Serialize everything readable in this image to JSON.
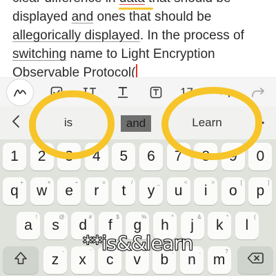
{
  "note": {
    "lines": [
      {
        "segments": [
          {
            "text": "clear difference in ",
            "style": ""
          },
          {
            "text": "data",
            "style": "u u-red"
          },
          {
            "text": " that should be",
            "style": ""
          }
        ]
      },
      {
        "segments": [
          {
            "text": "displayed ",
            "style": ""
          },
          {
            "text": "and",
            "style": "u"
          },
          {
            "text": " ones that should be",
            "style": ""
          }
        ]
      },
      {
        "segments": [
          {
            "text": "allegorically displayed",
            "style": "u"
          },
          {
            "text": ". In the process of",
            "style": ""
          }
        ]
      },
      {
        "segments": [
          {
            "text": "switching",
            "style": "u"
          },
          {
            "text": " name to Light Encryption",
            "style": ""
          }
        ]
      },
      {
        "segments": [
          {
            "text": "Observable Protocol(",
            "style": ""
          }
        ]
      }
    ]
  },
  "toolbar": {
    "font_size": "17",
    "icons": [
      "pen-icon",
      "checkbox-icon",
      "text-format-icon",
      "text-style-icon",
      "text-box-icon",
      "undo-icon",
      "redo-icon"
    ]
  },
  "suggestions": {
    "left": "is",
    "middle": "and",
    "right": "Learn",
    "more": "••"
  },
  "keyboard": {
    "row1": [
      {
        "label": "1"
      },
      {
        "label": "2"
      },
      {
        "label": "3"
      },
      {
        "label": "4"
      },
      {
        "label": "5"
      },
      {
        "label": "6"
      },
      {
        "label": "7"
      },
      {
        "label": "8"
      },
      {
        "label": "9"
      },
      {
        "label": "0"
      }
    ],
    "row2": [
      {
        "label": "q",
        "hint": "+"
      },
      {
        "label": "w",
        "hint": "×"
      },
      {
        "label": "e",
        "hint": "÷"
      },
      {
        "label": "r",
        "hint": "="
      },
      {
        "label": "t",
        "hint": "/"
      },
      {
        "label": "y",
        "hint": "_"
      },
      {
        "label": "u",
        "hint": "<"
      },
      {
        "label": "i",
        "hint": ">"
      },
      {
        "label": "o",
        "hint": "["
      },
      {
        "label": "p",
        "hint": "]"
      }
    ],
    "row3": [
      {
        "label": "a",
        "hint": "!"
      },
      {
        "label": "s",
        "hint": "@"
      },
      {
        "label": "d",
        "hint": "#"
      },
      {
        "label": "f",
        "hint": "$"
      },
      {
        "label": "g",
        "hint": "%"
      },
      {
        "label": "h",
        "hint": "^"
      },
      {
        "label": "j",
        "hint": "&"
      },
      {
        "label": "k",
        "hint": "*"
      },
      {
        "label": "l",
        "hint": "("
      }
    ],
    "row4": [
      {
        "label": "z",
        "hint": "-"
      },
      {
        "label": "x",
        "hint": "'"
      },
      {
        "label": "c",
        "hint": "\""
      },
      {
        "label": "v",
        "hint": ":"
      },
      {
        "label": "b",
        "hint": ";"
      },
      {
        "label": "n",
        "hint": ","
      },
      {
        "label": "m",
        "hint": "?"
      }
    ]
  },
  "overlay_caption": "**is&&learn",
  "colors": {
    "highlight": "#f7c52a",
    "caret": "#e0322c",
    "keyboard_bg": "#dfe3dc"
  }
}
